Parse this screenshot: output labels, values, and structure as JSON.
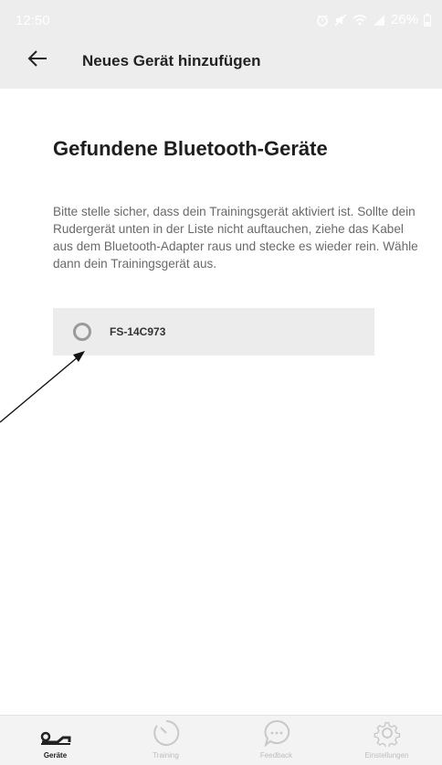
{
  "status_bar": {
    "time": "12:50",
    "battery_percent": "26%",
    "icons": [
      "alarm-icon",
      "mute-icon",
      "wifi-icon",
      "signal-icon",
      "battery-icon"
    ]
  },
  "app_bar": {
    "back_icon": "arrow-left-icon",
    "title": "Neues Gerät hinzufügen"
  },
  "main": {
    "heading": "Gefundene Bluetooth-Geräte",
    "info_text": "Bitte stelle sicher, dass dein Trainingsgerät aktiviert ist. Sollte dein Rudergerät unten in der Liste nicht auftauchen, ziehe das Kabel aus dem Bluetooth-Adapter raus und stecke es wieder rein. Wähle dann dein Trainingsgerät aus.",
    "devices": [
      {
        "name": "FS-14C973",
        "selected": false
      }
    ]
  },
  "bottom_nav": {
    "items": [
      {
        "label": "Geräte",
        "icon": "rowing-machine-icon",
        "active": true
      },
      {
        "label": "Training",
        "icon": "timer-icon",
        "active": false
      },
      {
        "label": "Feedback",
        "icon": "chat-bubble-icon",
        "active": false
      },
      {
        "label": "Einstellungen",
        "icon": "gear-icon",
        "active": false
      }
    ]
  },
  "colors": {
    "app_bar_bg": "#ededed",
    "device_row_bg": "#ececec",
    "active_nav": "#222222",
    "inactive_nav": "#bdbdbd"
  }
}
